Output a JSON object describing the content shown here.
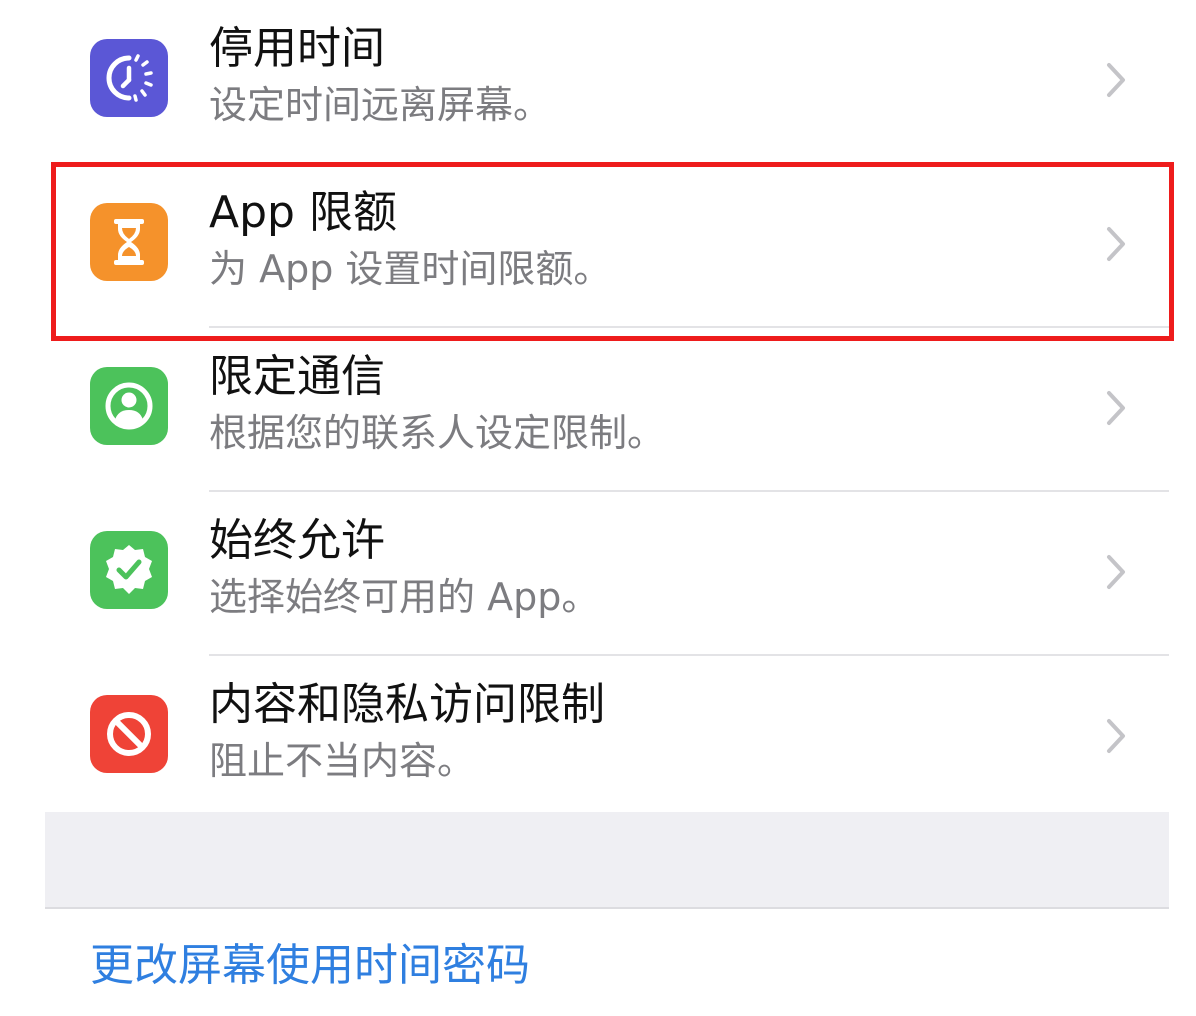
{
  "colors": {
    "downtime_icon_bg": "#5b57d6",
    "app_limits_icon_bg": "#f5922b",
    "communication_icon_bg": "#4cc25b",
    "always_allowed_icon_bg": "#4cc25b",
    "content_privacy_icon_bg": "#ef4337",
    "highlight_border": "#ee1c1c",
    "link": "#2f7fe0",
    "subtitle_text": "#7c7c80"
  },
  "items": [
    {
      "title": "停用时间",
      "subtitle": "设定时间远离屏幕。",
      "icon": "downtime-moon-clock-icon"
    },
    {
      "title": "App 限额",
      "subtitle": "为 App 设置时间限额。",
      "icon": "hourglass-icon",
      "highlighted": true
    },
    {
      "title": "限定通信",
      "subtitle": "根据您的联系人设定限制。",
      "icon": "person-circle-icon"
    },
    {
      "title": "始终允许",
      "subtitle": "选择始终可用的 App。",
      "icon": "checkmark-seal-icon"
    },
    {
      "title": "内容和隐私访问限制",
      "subtitle": "阻止不当内容。",
      "icon": "prohibited-icon"
    }
  ],
  "footer": {
    "change_passcode_label": "更改屏幕使用时间密码"
  }
}
